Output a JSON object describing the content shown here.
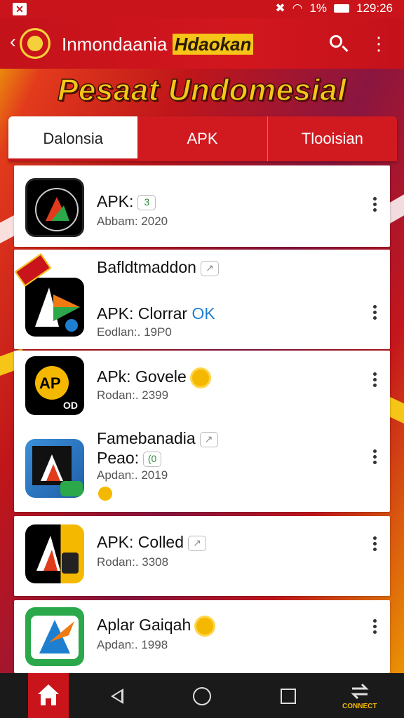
{
  "status_bar": {
    "battery": "1%",
    "time": "129:26"
  },
  "app_bar": {
    "title_main": "Inmondaania",
    "title_highlight": "Hdaokan"
  },
  "banner": {
    "headline": "Pesaat Undomesial"
  },
  "tabs": [
    {
      "label": "Dalonsia",
      "active": true
    },
    {
      "label": "APK",
      "active": false
    },
    {
      "label": "Tlooisian",
      "active": false
    }
  ],
  "apps": [
    {
      "name": "APK:",
      "chip": "3",
      "meta": "Abbam: 2020"
    },
    {
      "header": "Bafldtmaddon",
      "name_prefix": "APK: Clorrar",
      "name_suffix": "OK",
      "meta": "Eodlan:. 19P0"
    },
    {
      "name": "APk: Govele",
      "meta": "Rodan:. 2399",
      "sub": "OD"
    },
    {
      "name_line1": "Famebanadia",
      "name_line2": "Peao:",
      "chip": "(0",
      "meta": "Apdan:. 2019"
    },
    {
      "name": "APK: Colled",
      "meta": "Rodan:. 3308"
    },
    {
      "name": "Aplar Gaiqah",
      "meta": "Apdan:. 1998"
    }
  ],
  "nav": {
    "connect_label": "CONNECT"
  },
  "colors": {
    "brand_red": "#c8141a",
    "gold": "#f5c518"
  }
}
